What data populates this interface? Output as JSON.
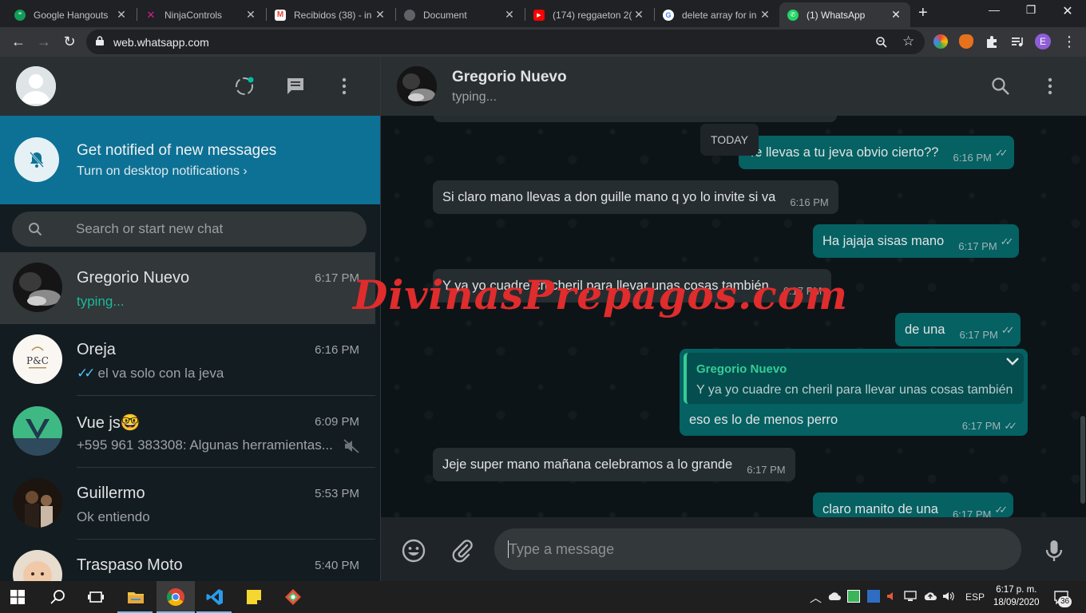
{
  "browser": {
    "tabs": [
      {
        "title": "Google Hangouts",
        "icon": "hangouts-icon",
        "color": "#0f9d58"
      },
      {
        "title": "NinjaControls",
        "icon": "ninjacontrols-icon",
        "color": "#d61e8d"
      },
      {
        "title": "Recibidos (38) - in",
        "icon": "gmail-icon",
        "color": "#ea4335"
      },
      {
        "title": "Document",
        "icon": "globe-icon",
        "color": "#5f6368"
      },
      {
        "title": "(174) reggaeton 2(",
        "icon": "youtube-icon",
        "color": "#ff0000"
      },
      {
        "title": "delete array for in",
        "icon": "google-icon",
        "color": "#4285f4"
      },
      {
        "title": "(1) WhatsApp",
        "icon": "whatsapp-icon",
        "color": "#25d366",
        "active": true
      }
    ],
    "url": "web.whatsapp.com",
    "profile_initial": "E"
  },
  "sidebar": {
    "notification": {
      "title": "Get notified of new messages",
      "subtitle": "Turn on desktop notifications ›"
    },
    "search_placeholder": "Search or start new chat",
    "chats": [
      {
        "name": "Gregorio Nuevo",
        "time": "6:17 PM",
        "preview": "typing...",
        "typing": true
      },
      {
        "name": "Oreja",
        "time": "6:16 PM",
        "preview": "el va solo con la jeva",
        "ticks": "✓✓"
      },
      {
        "name": "Vue js🤓",
        "time": "6:09 PM",
        "preview": "+595 961 383308: Algunas herramientas...",
        "muted": true
      },
      {
        "name": "Guillermo",
        "time": "5:53 PM",
        "preview": "Ok entiendo"
      },
      {
        "name": "Traspaso Moto",
        "time": "5:40 PM",
        "preview": ""
      }
    ]
  },
  "conversation": {
    "name": "Gregorio Nuevo",
    "status": "typing...",
    "date_chip": "TODAY",
    "messages": [
      {
        "dir": "out",
        "text": "Te llevas a tu jeva obvio cierto??",
        "time": "6:16 PM"
      },
      {
        "dir": "in",
        "text": "Si claro mano llevas a don guille mano q yo lo invite si va",
        "time": "6:16 PM"
      },
      {
        "dir": "out",
        "text": "Ha jajaja sisas mano",
        "time": "6:17 PM"
      },
      {
        "dir": "in",
        "text": "Y ya yo cuadre cn cheril para llevar unas cosas también",
        "time": "6:17 PM"
      },
      {
        "dir": "out",
        "text": "de una",
        "time": "6:17 PM"
      },
      {
        "dir": "in",
        "text": "Jeje super mano mañana celebramos a lo grande",
        "time": "6:17 PM"
      },
      {
        "dir": "out",
        "text": "claro manito de una",
        "time": "6:17 PM"
      }
    ],
    "reply": {
      "quoted_name": "Gregorio Nuevo",
      "quoted_text": "Y ya yo cuadre cn cheril para llevar unas cosas también",
      "text": "eso es lo de menos perro",
      "time": "6:17 PM"
    },
    "input_placeholder": "Type a message",
    "watermark": "DivinasPrepagos.com"
  },
  "taskbar": {
    "language": "ESP",
    "time": "6:17 p. m.",
    "date": "18/09/2020",
    "notification_count": "36"
  }
}
